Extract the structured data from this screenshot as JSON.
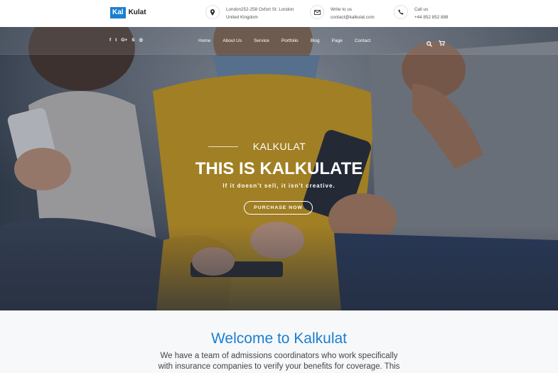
{
  "brand": {
    "logo_box": "Kal",
    "logo_text": "Kulat",
    "accent": "#1a7fd1"
  },
  "contacts": [
    {
      "icon": "map-pin-icon",
      "line1": "London252-258 Oxfort St. London",
      "line2": "United Kingdom"
    },
    {
      "icon": "envelope-icon",
      "line1": "Write to us",
      "line2": "contact@kalkulat.com"
    },
    {
      "icon": "phone-icon",
      "line1": "Call us",
      "line2": "+44 852 852 888"
    }
  ],
  "social": [
    {
      "icon": "facebook-icon",
      "glyph": "f"
    },
    {
      "icon": "twitter-icon",
      "glyph": "t"
    },
    {
      "icon": "google-plus-icon",
      "glyph": "G+"
    },
    {
      "icon": "skype-icon",
      "glyph": "S"
    },
    {
      "icon": "instagram-icon",
      "glyph": "◎"
    }
  ],
  "nav": [
    "Home",
    "About Us",
    "Service",
    "Portfolio",
    "Blog",
    "Page",
    "Contact"
  ],
  "hero": {
    "eyebrow": "KALKULAT",
    "title": "THIS IS KALKULATE",
    "tagline": "If it doesn't sell, it isn't creative.",
    "button": "PURCHASE NOW"
  },
  "welcome": {
    "title": "Welcome to Kalkulat",
    "body": "We have a team of admissions coordinators who work specifically with insurance companies to verify your benefits for coverage. This"
  }
}
